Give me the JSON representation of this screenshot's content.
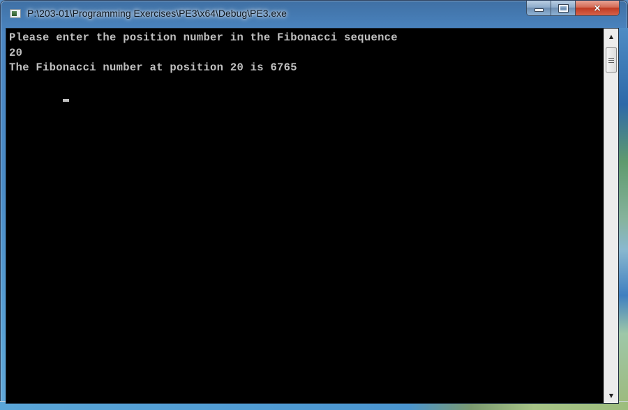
{
  "window": {
    "title": "P:\\203-01\\Programming Exercises\\PE3\\x64\\Debug\\PE3.exe",
    "icon": "console-app-icon",
    "buttons": {
      "minimize": "minimize-icon",
      "maximize": "maximize-icon",
      "close": "×"
    }
  },
  "console": {
    "lines": [
      "Please enter the position number in the Fibonacci sequence",
      "20",
      "The Fibonacci number at position 20 is 6765"
    ],
    "cursor": "blinking-underscore-cursor"
  },
  "scrollbar": {
    "up_arrow": "▲",
    "down_arrow": "▼",
    "position": 0.0
  }
}
